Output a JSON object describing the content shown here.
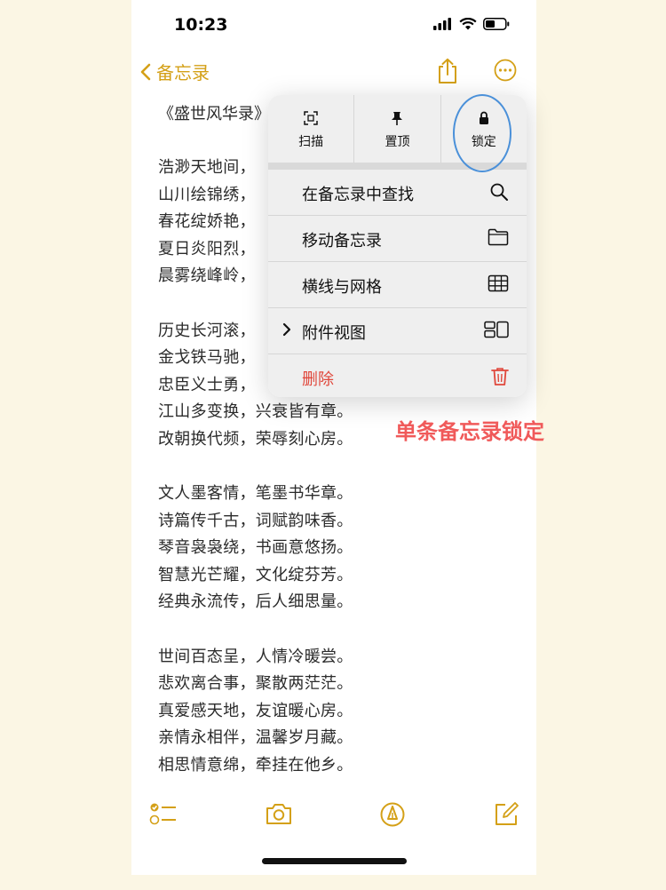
{
  "status": {
    "time": "10:23"
  },
  "navbar": {
    "back_label": "备忘录"
  },
  "note": {
    "title": "《盛世风华录》",
    "stanzas": [
      [
        "浩渺天地间，",
        "山川绘锦绣，",
        "春花绽娇艳，",
        "夏日炎阳烈，",
        "晨雾绕峰岭，"
      ],
      [
        "历史长河滚，",
        "金戈铁马驰，",
        "忠臣义士勇，",
        "江山多变换，兴衰皆有章。",
        "改朝换代频，荣辱刻心房。"
      ],
      [
        "文人墨客情，笔墨书华章。",
        "诗篇传千古，词赋韵味香。",
        "琴音袅袅绕，书画意悠扬。",
        "智慧光芒耀，文化绽芬芳。",
        "经典永流传，后人细思量。"
      ],
      [
        "世间百态呈，人情冷暖尝。",
        "悲欢离合事，聚散两茫茫。",
        "真爱感天地，友谊暖心房。",
        "亲情永相伴，温馨岁月藏。",
        "相思情意绵，牵挂在他乡。"
      ]
    ]
  },
  "menu": {
    "top_actions": [
      {
        "label": "扫描",
        "icon": "scan-icon"
      },
      {
        "label": "置顶",
        "icon": "pin-icon"
      },
      {
        "label": "锁定",
        "icon": "lock-icon"
      }
    ],
    "items": [
      {
        "label": "在备忘录中查找",
        "icon": "search-icon"
      },
      {
        "label": "移动备忘录",
        "icon": "folder-icon"
      },
      {
        "label": "横线与网格",
        "icon": "grid-icon"
      },
      {
        "label": "附件视图",
        "icon": "attachment-view-icon"
      },
      {
        "label": "删除",
        "icon": "trash-icon"
      }
    ]
  },
  "annotation": "单条备忘录锁定",
  "colors": {
    "accent": "#d4a017",
    "danger": "#e0473b",
    "annotation": "#f05a5a",
    "ring": "#4a90d9",
    "page_bg": "#fbf6e4"
  }
}
